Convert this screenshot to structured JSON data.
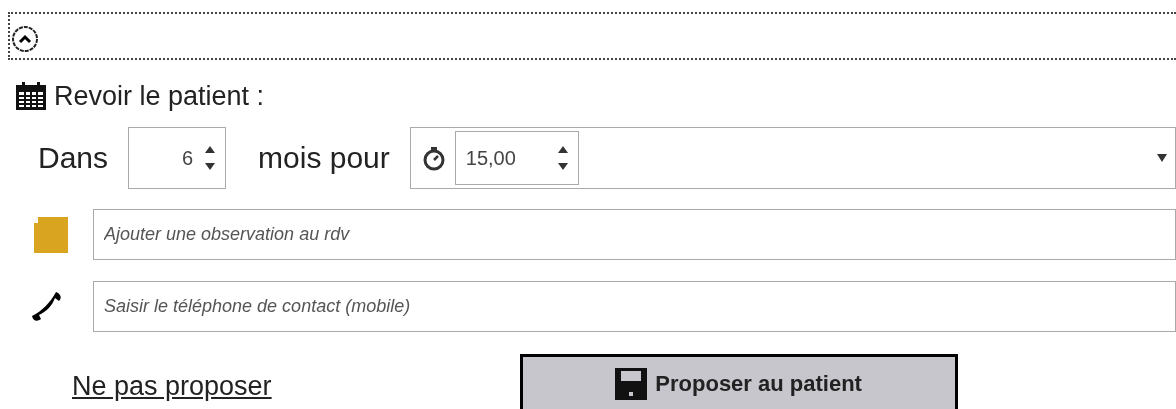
{
  "section": {
    "title": "Revoir le patient :"
  },
  "delay": {
    "prefix": "Dans",
    "months": "6",
    "middle": "mois pour",
    "duration": "15,00"
  },
  "fields": [
    {
      "kind": "note",
      "placeholder": "Ajouter une observation au rdv"
    },
    {
      "kind": "phone",
      "placeholder": "Saisir le téléphone de contact (mobile)"
    }
  ],
  "actions": {
    "link": "Ne pas proposer",
    "button": "Proposer au patient"
  }
}
